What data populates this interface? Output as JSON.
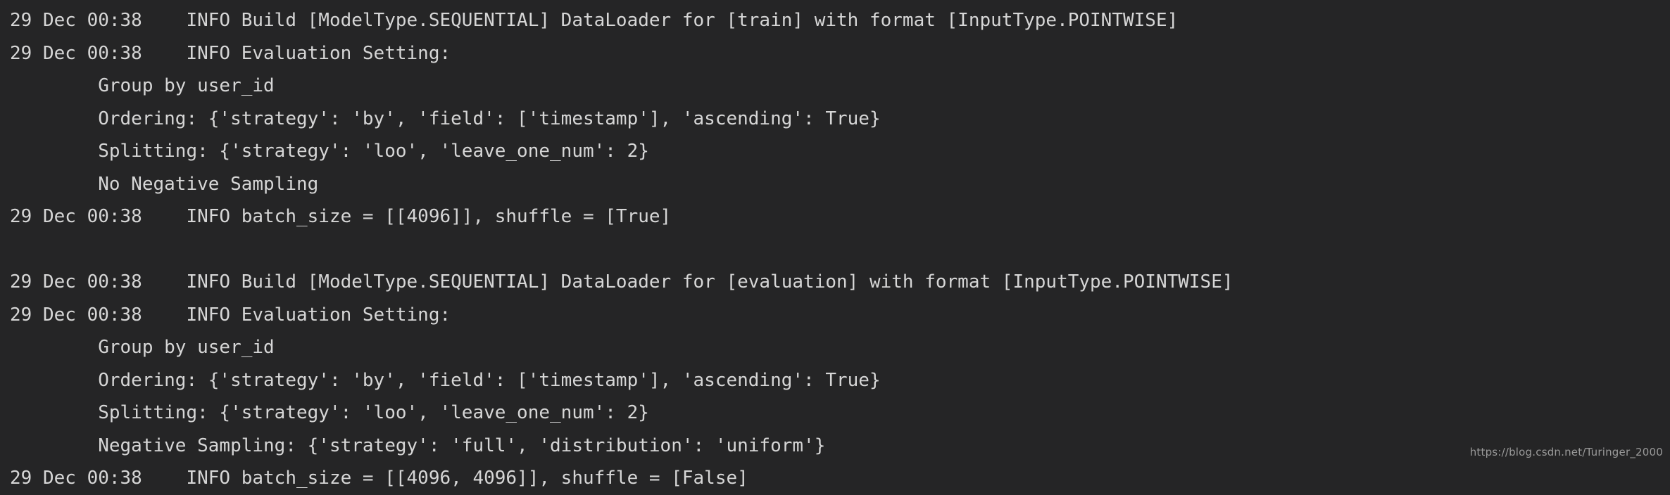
{
  "terminal": {
    "background_color": "#252526",
    "text_color": "#d6d6d6",
    "watermark": "https://blog.csdn.net/Turinger_2000",
    "lines": [
      {
        "id": "line-1",
        "text": "29 Dec 00:38    INFO Build [ModelType.SEQUENTIAL] DataLoader for [train] with format [InputType.POINTWISE]",
        "timestamp": "29 Dec 00:38",
        "level": "INFO",
        "kind": "log-entry"
      },
      {
        "id": "line-2",
        "text": "29 Dec 00:38    INFO Evaluation Setting:",
        "timestamp": "29 Dec 00:38",
        "level": "INFO",
        "kind": "log-entry"
      },
      {
        "id": "line-3",
        "text": "        Group by user_id",
        "kind": "continuation"
      },
      {
        "id": "line-4",
        "text": "        Ordering: {'strategy': 'by', 'field': ['timestamp'], 'ascending': True}",
        "kind": "continuation"
      },
      {
        "id": "line-5",
        "text": "        Splitting: {'strategy': 'loo', 'leave_one_num': 2}",
        "kind": "continuation"
      },
      {
        "id": "line-6",
        "text": "        No Negative Sampling",
        "kind": "continuation"
      },
      {
        "id": "line-7",
        "text": "29 Dec 00:38    INFO batch_size = [[4096]], shuffle = [True]",
        "timestamp": "29 Dec 00:38",
        "level": "INFO",
        "kind": "log-entry"
      },
      {
        "id": "line-8",
        "text": "",
        "kind": "blank"
      },
      {
        "id": "line-9",
        "text": "29 Dec 00:38    INFO Build [ModelType.SEQUENTIAL] DataLoader for [evaluation] with format [InputType.POINTWISE]",
        "timestamp": "29 Dec 00:38",
        "level": "INFO",
        "kind": "log-entry"
      },
      {
        "id": "line-10",
        "text": "29 Dec 00:38    INFO Evaluation Setting:",
        "timestamp": "29 Dec 00:38",
        "level": "INFO",
        "kind": "log-entry"
      },
      {
        "id": "line-11",
        "text": "        Group by user_id",
        "kind": "continuation"
      },
      {
        "id": "line-12",
        "text": "        Ordering: {'strategy': 'by', 'field': ['timestamp'], 'ascending': True}",
        "kind": "continuation"
      },
      {
        "id": "line-13",
        "text": "        Splitting: {'strategy': 'loo', 'leave_one_num': 2}",
        "kind": "continuation"
      },
      {
        "id": "line-14",
        "text": "        Negative Sampling: {'strategy': 'full', 'distribution': 'uniform'}",
        "kind": "continuation"
      },
      {
        "id": "line-15",
        "text": "29 Dec 00:38    INFO batch_size = [[4096, 4096]], shuffle = [False]",
        "timestamp": "29 Dec 00:38",
        "level": "INFO",
        "kind": "log-entry"
      }
    ]
  }
}
